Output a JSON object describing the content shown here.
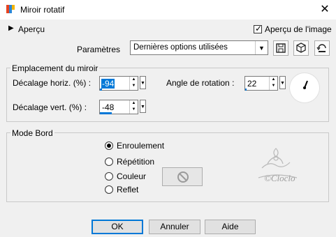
{
  "window": {
    "title": "Miroir rotatif"
  },
  "header": {
    "apercu_label": "Aperçu",
    "preview_label": "Aperçu de l'image",
    "preview_checked": true
  },
  "params": {
    "label": "Paramètres",
    "preset_value": "Dernières options utilisées"
  },
  "mirror": {
    "group_title": "Emplacement du miroir",
    "hoffset_label": "Décalage horiz. (%) :",
    "hoffset_value": "-94",
    "voffset_label": "Décalage vert. (%) :",
    "voffset_value": "-48",
    "angle_label": "Angle de rotation :",
    "angle_value": "22"
  },
  "edge": {
    "group_title": "Mode Bord",
    "options": [
      "Enroulement",
      "Répétition",
      "Couleur",
      "Reflet"
    ],
    "selected": "Enroulement"
  },
  "watermark": {
    "text": "©Cloclo"
  },
  "buttons": {
    "ok": "OK",
    "cancel": "Annuler",
    "help": "Aide"
  },
  "colors": {
    "accent": "#0078d7"
  },
  "icons": [
    "app-icon",
    "close-icon",
    "save-icon",
    "cube-icon",
    "reset-icon",
    "no-icon"
  ]
}
